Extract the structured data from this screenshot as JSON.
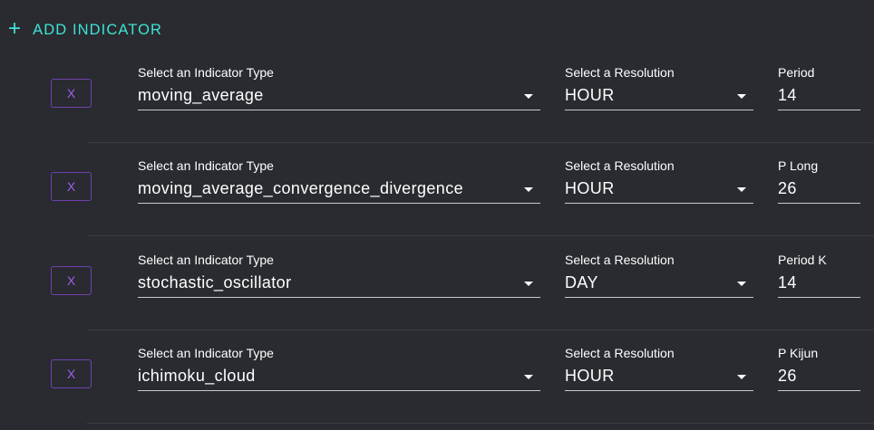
{
  "add_button": {
    "icon": "plus-icon",
    "label": "ADD INDICATOR"
  },
  "rows": [
    {
      "remove_label": "X",
      "type_label": "Select an Indicator Type",
      "type_value": "moving_average",
      "res_label": "Select a Resolution",
      "res_value": "HOUR",
      "param_label": "Period",
      "param_value": "14"
    },
    {
      "remove_label": "X",
      "type_label": "Select an Indicator Type",
      "type_value": "moving_average_convergence_divergence",
      "res_label": "Select a Resolution",
      "res_value": "HOUR",
      "param_label": "P Long",
      "param_value": "26"
    },
    {
      "remove_label": "X",
      "type_label": "Select an Indicator Type",
      "type_value": "stochastic_oscillator",
      "res_label": "Select a Resolution",
      "res_value": "DAY",
      "param_label": "Period K",
      "param_value": "14"
    },
    {
      "remove_label": "X",
      "type_label": "Select an Indicator Type",
      "type_value": "ichimoku_cloud",
      "res_label": "Select a Resolution",
      "res_value": "HOUR",
      "param_label": "P Kijun",
      "param_value": "26"
    }
  ],
  "colors": {
    "background": "#292b30",
    "accent": "#3fe3d5",
    "remove": "#a25ef0",
    "underline": "#c9cacc"
  }
}
